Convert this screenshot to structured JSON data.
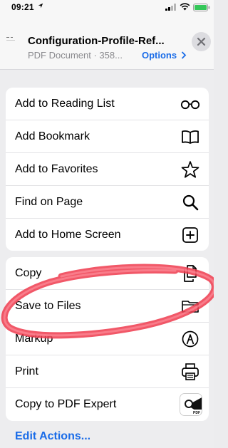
{
  "status_bar": {
    "time": "09:21"
  },
  "header": {
    "title": "Configuration-Profile-Ref...",
    "subtitle": "PDF Document · 358...",
    "options_label": "Options"
  },
  "group1": {
    "items": [
      {
        "label": "Add to Reading List",
        "icon": "glasses-icon"
      },
      {
        "label": "Add Bookmark",
        "icon": "book-icon"
      },
      {
        "label": "Add to Favorites",
        "icon": "star-icon"
      },
      {
        "label": "Find on Page",
        "icon": "magnifier-icon"
      },
      {
        "label": "Add to Home Screen",
        "icon": "plus-square-icon"
      }
    ]
  },
  "group2": {
    "items": [
      {
        "label": "Copy",
        "icon": "copy-icon"
      },
      {
        "label": "Save to Files",
        "icon": "folder-icon"
      },
      {
        "label": "Markup",
        "icon": "markup-icon"
      },
      {
        "label": "Print",
        "icon": "printer-icon"
      },
      {
        "label": "Copy to PDF Expert",
        "icon": "pdf-expert-app-icon"
      }
    ]
  },
  "footer": {
    "edit_actions_label": "Edit Actions..."
  },
  "colors": {
    "accent": "#1a6ce8",
    "annotation_red": "#ee3b4e",
    "battery_green": "#34c759"
  }
}
